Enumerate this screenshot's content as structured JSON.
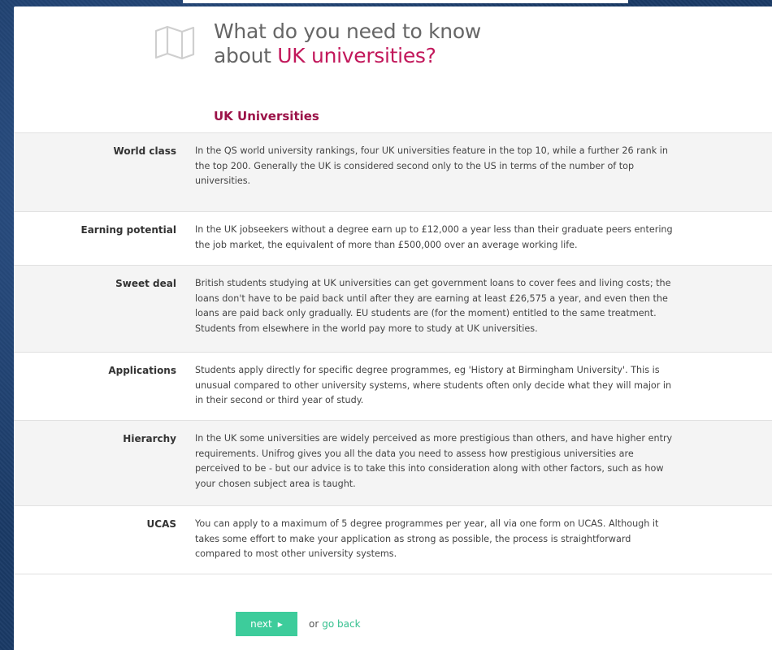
{
  "header": {
    "icon": "map-icon",
    "heading_line1": "What do you need to know",
    "heading_line2_prefix": "about ",
    "heading_line2_accent": "UK universities?"
  },
  "section": {
    "title": "UK Universities"
  },
  "rows": [
    {
      "label": "World class",
      "text": "In the QS world university rankings, four UK universities feature in the top 10, while a further 26 rank in the top 200. Generally the UK is considered second only to the US in terms of the number of top universities."
    },
    {
      "label": "Earning potential",
      "text": "In the UK jobseekers without a degree earn up to £12,000 a year less than their graduate peers entering the job market, the equivalent of more than £500,000 over an average working life."
    },
    {
      "label": "Sweet deal",
      "text": "British students studying at UK universities can get government loans to cover fees and living costs; the loans don't have to be paid back until after they are earning at least £26,575 a year, and even then the loans are paid back only gradually. EU students are (for the moment) entitled to the same treatment. Students from elsewhere in the world pay more to study at UK universities."
    },
    {
      "label": "Applications",
      "text": "Students apply directly for specific degree programmes, eg 'History at Birmingham University'. This is unusual compared to other university systems, where students often only decide what they will major in in their second or third year of study."
    },
    {
      "label": "Hierarchy",
      "text": "In the UK some universities are widely perceived as more prestigious than others, and have higher entry requirements. Unifrog gives you all the data you need to assess how prestigious universities are perceived to be - but our advice is to take this into consideration along with other factors, such as how your chosen subject area is taught."
    },
    {
      "label": "UCAS",
      "text": "You can apply to a maximum of 5 degree programmes per year, all via one form on UCAS. Although it takes some effort to make your application as strong as possible, the process is straightforward compared to most other university systems."
    }
  ],
  "nav": {
    "next_label": "next",
    "next_icon": "play-arrow-icon",
    "or_text": "or",
    "go_back_label": "go back"
  },
  "colors": {
    "accent": "#c2185b",
    "section_title": "#9b1248",
    "button": "#3dcc9b",
    "link": "#35c08f"
  }
}
